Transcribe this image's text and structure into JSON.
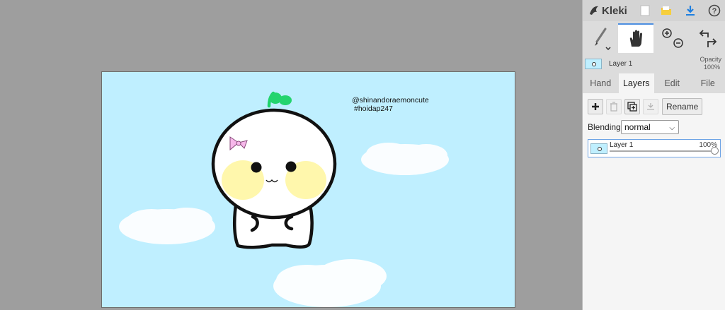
{
  "app": {
    "name": "Kleki"
  },
  "toolbar": {
    "new_icon": "new-file-icon",
    "open_icon": "folder-icon",
    "save_icon": "download-icon",
    "help_icon": "help-icon"
  },
  "tools": {
    "brush": "brush-icon",
    "hand": "hand-icon",
    "zoom": "zoom-icon",
    "undo_redo": "undo-redo-icon"
  },
  "current_layer": {
    "name": "Layer 1",
    "opacity_label": "Opacity",
    "opacity_value": "100%"
  },
  "tabs": [
    "Hand",
    "Layers",
    "Edit",
    "File"
  ],
  "active_tab": "Layers",
  "layer_buttons": {
    "rename": "Rename"
  },
  "blending": {
    "label": "Blending",
    "value": "normal"
  },
  "layers": [
    {
      "name": "Layer 1",
      "opacity": "100%",
      "opacity_fraction": 1.0
    }
  ],
  "canvas": {
    "watermark_line1": "@shinandoraemoncute",
    "watermark_line2": "#hoidap247"
  },
  "colors": {
    "accent": "#4d8fe0",
    "canvas_bg": "#bfefff",
    "workspace_bg": "#9e9e9e",
    "panel_bg": "#dcdcdc"
  }
}
